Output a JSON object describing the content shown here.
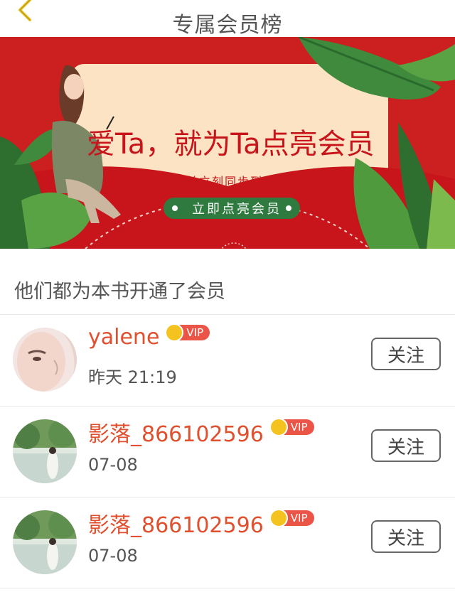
{
  "header": {
    "title": "专属会员榜",
    "back_icon": "chevron-left-icon",
    "back_color": "#e8c21c"
  },
  "banner": {
    "title": "爱Ta，就为Ta点亮会员",
    "subtitle": "点亮成功，收益立刻同步到作者大大账户",
    "cta_label": "立即点亮会员",
    "colors": {
      "red": "#cc1f1f",
      "card": "#fbe3c4",
      "green": "#2f7a3e"
    }
  },
  "section": {
    "label": "他们都为本书开通了会员"
  },
  "members": [
    {
      "name": "yalene",
      "badge": "VIP",
      "time": "昨天 21:19",
      "follow_label": "关注"
    },
    {
      "name": "影落_866102596",
      "badge": "VIP",
      "time": "07-08",
      "follow_label": "关注"
    },
    {
      "name": "影落_866102596",
      "badge": "VIP",
      "time": "07-08",
      "follow_label": "关注"
    }
  ]
}
